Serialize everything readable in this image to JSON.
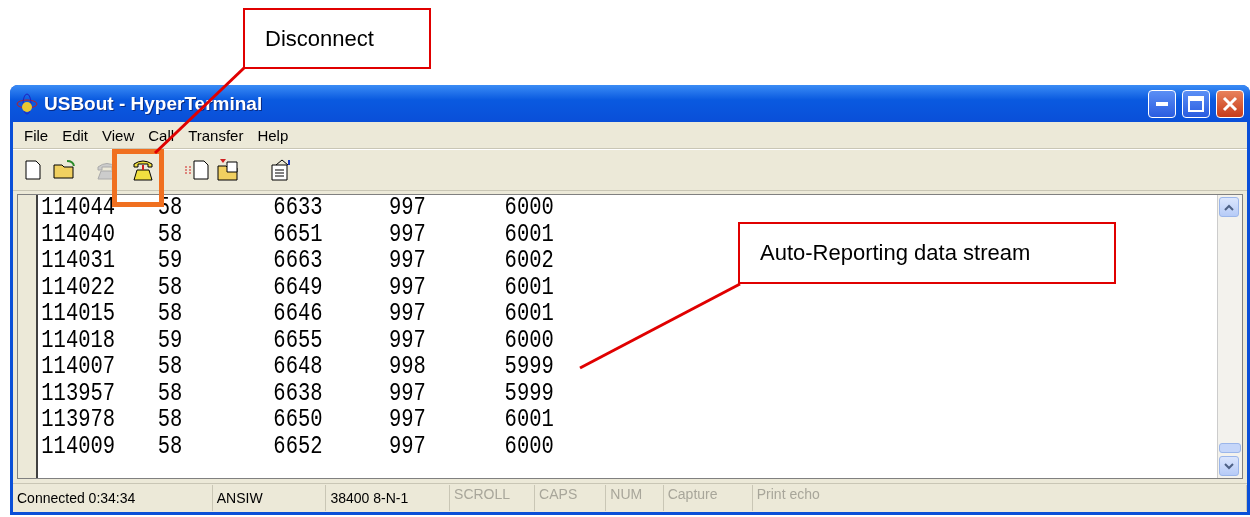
{
  "window": {
    "title": "USBout - HyperTerminal"
  },
  "menu": [
    "File",
    "Edit",
    "View",
    "Call",
    "Transfer",
    "Help"
  ],
  "toolbar": [
    {
      "kind": "new",
      "disabled": false
    },
    {
      "kind": "open",
      "disabled": false
    },
    {
      "kind": "connect",
      "disabled": true
    },
    {
      "kind": "disconnect",
      "disabled": false
    },
    {
      "kind": "send",
      "disabled": false
    },
    {
      "kind": "receive",
      "disabled": false
    },
    {
      "kind": "properties",
      "disabled": false
    }
  ],
  "terminal": {
    "rows": [
      [
        "114044",
        "58",
        "6633",
        "997",
        "6000"
      ],
      [
        "114040",
        "58",
        "6651",
        "997",
        "6001"
      ],
      [
        "114031",
        "59",
        "6663",
        "997",
        "6002"
      ],
      [
        "114022",
        "58",
        "6649",
        "997",
        "6001"
      ],
      [
        "114015",
        "58",
        "6646",
        "997",
        "6001"
      ],
      [
        "114018",
        "59",
        "6655",
        "997",
        "6000"
      ],
      [
        "114007",
        "58",
        "6648",
        "998",
        "5999"
      ],
      [
        "113957",
        "58",
        "6638",
        "997",
        "5999"
      ],
      [
        "113978",
        "58",
        "6650",
        "997",
        "6001"
      ],
      [
        "114009",
        "58",
        "6652",
        "997",
        "6000"
      ]
    ]
  },
  "status_bar": [
    {
      "text": "Connected 0:34:34",
      "disabled": false
    },
    {
      "text": "ANSIW",
      "disabled": false
    },
    {
      "text": "38400 8-N-1",
      "disabled": false
    },
    {
      "text": "SCROLL",
      "disabled": true
    },
    {
      "text": "CAPS",
      "disabled": true
    },
    {
      "text": "NUM",
      "disabled": true
    },
    {
      "text": "Capture",
      "disabled": true
    },
    {
      "text": "Print echo",
      "disabled": true
    }
  ],
  "callouts": [
    {
      "text": "Disconnect"
    },
    {
      "text": "Auto-Reporting data stream"
    }
  ]
}
